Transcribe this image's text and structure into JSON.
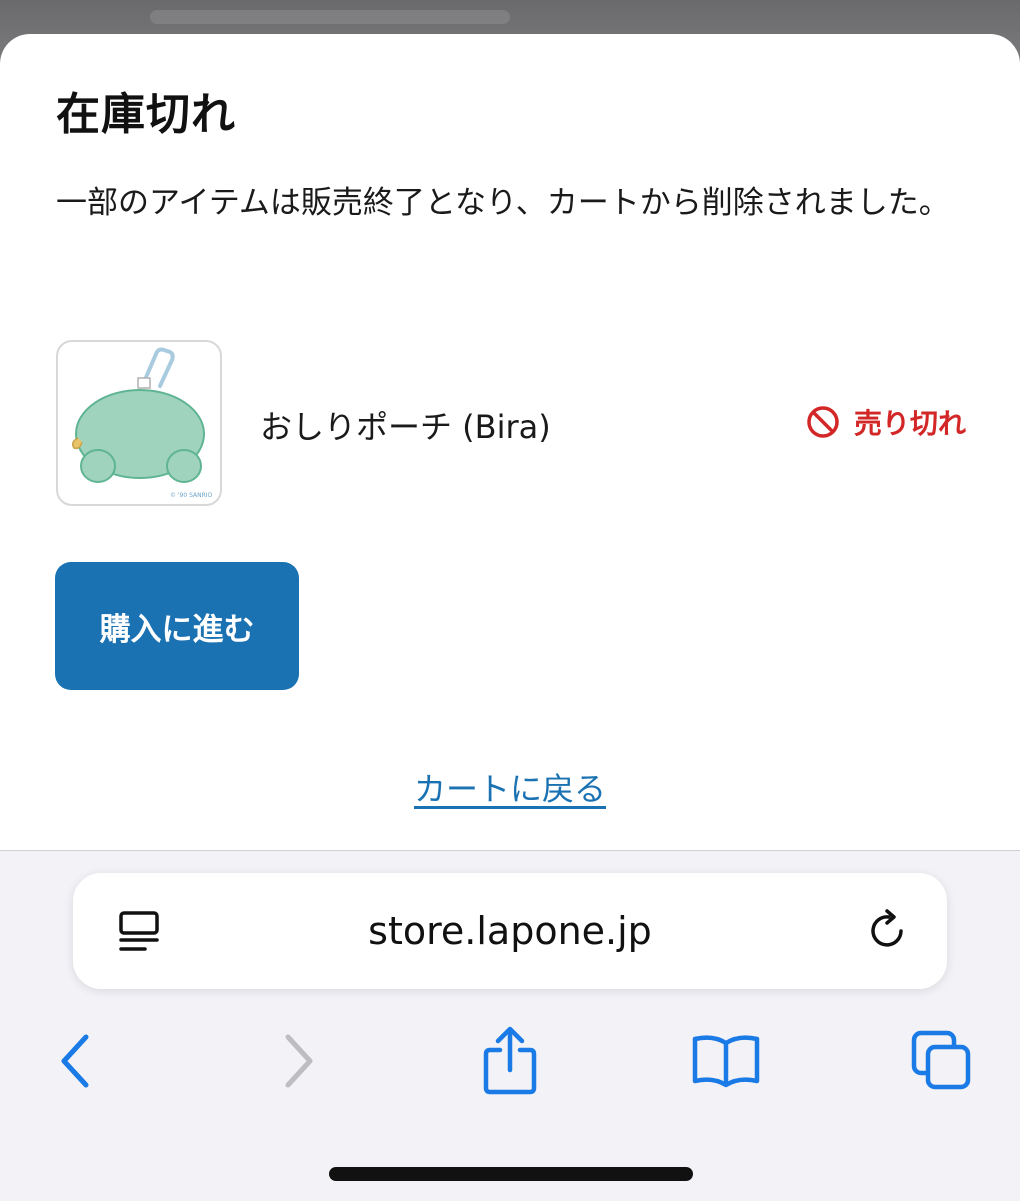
{
  "dialog": {
    "title": "在庫切れ",
    "message": "一部のアイテムは販売終了となり、カートから削除されました。"
  },
  "item": {
    "name": "おしりポーチ (Bira)",
    "status_label": "売り切れ",
    "status_color": "#d32626",
    "image_alt": "おしりポーチ (Bira)",
    "image_copyright": "© '90 SANRIO"
  },
  "actions": {
    "checkout_label": "購入に進む",
    "back_to_cart_label": "カートに戻る",
    "accent_color": "#1b72b3"
  },
  "browser": {
    "url": "store.lapone.jp",
    "icons": {
      "reader": "reader-icon",
      "reload": "reload-icon",
      "back": "back-arrow-icon",
      "forward": "forward-arrow-icon",
      "share": "share-icon",
      "bookmarks": "bookmarks-icon",
      "tabs": "tabs-icon"
    }
  }
}
